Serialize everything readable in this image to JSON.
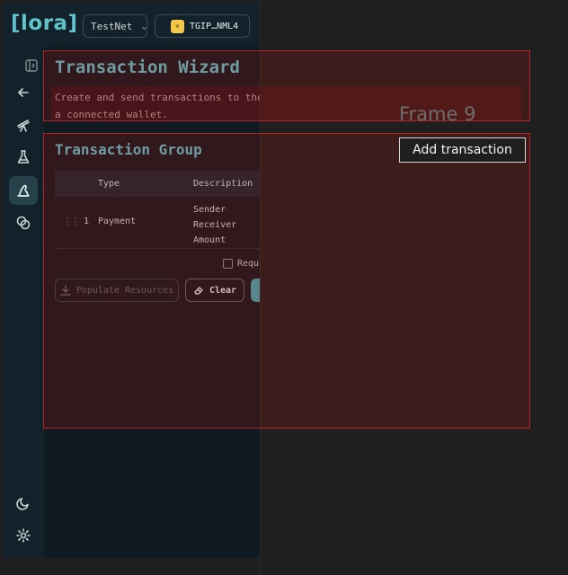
{
  "app": {
    "logo": "[lora]",
    "network_label": "TestNet",
    "wallet_label": "TGIP…NML4"
  },
  "sidebar": {
    "items": [
      {
        "icon": "arrow-left-icon"
      },
      {
        "icon": "telescope-icon"
      },
      {
        "icon": "flask-icon"
      },
      {
        "icon": "transaction-wizard-icon",
        "active": true
      },
      {
        "icon": "coins-icon"
      },
      {
        "icon": "moon-icon"
      },
      {
        "icon": "gear-icon"
      }
    ]
  },
  "main": {
    "title": "Transaction Wizard",
    "description_line1": "Create and send transactions to the",
    "description_line2": "a connected wallet.",
    "group_title": "Transaction Group",
    "table": {
      "headers": [
        "Type",
        "Description"
      ],
      "rows": [
        {
          "index": "1",
          "type": "Payment",
          "description": [
            "Sender",
            "Receiver",
            "Amount"
          ]
        }
      ]
    },
    "requirement_label": "Requ",
    "populate_button": "Populate Resources",
    "clear_button": "Clear"
  },
  "overlay": {
    "frame_label": "Frame 9",
    "add_transaction_button": "Add transaction"
  }
}
